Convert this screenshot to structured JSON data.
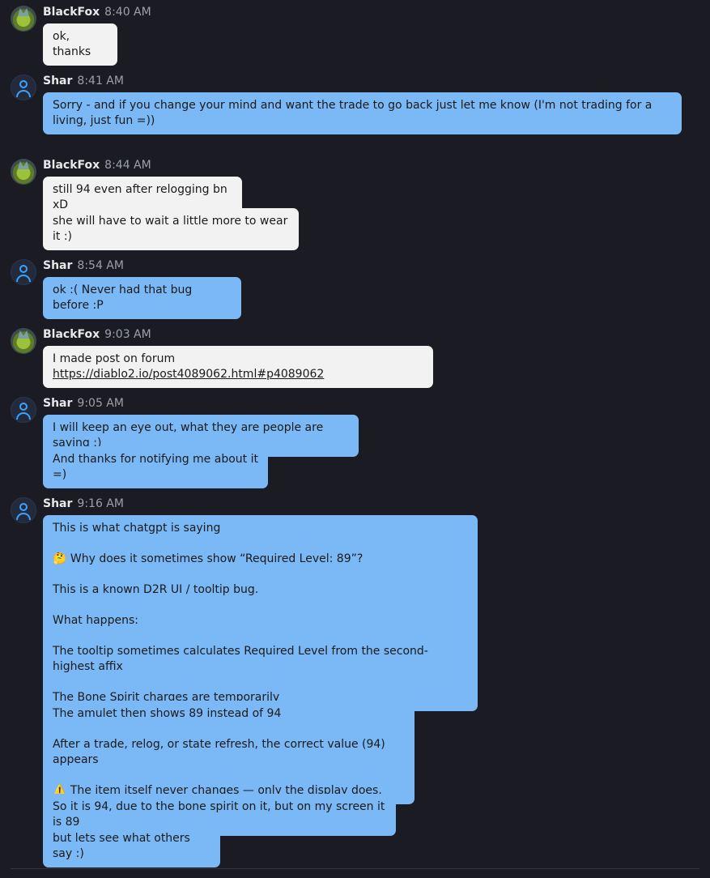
{
  "messages": [
    {
      "author": "BlackFox",
      "time": "8:40 AM",
      "bubbles": [
        "ok, thanks"
      ]
    },
    {
      "author": "Shar",
      "time": "8:41 AM",
      "bubbles": [
        "Sorry - and if you change your mind and want the trade to go back just let me know (I'm not trading for a living, just fun =))"
      ]
    },
    {
      "author": "BlackFox",
      "time": "8:44 AM",
      "bubbles": [
        "still 94 even after relogging bn xD",
        "she will have to wait a little more to wear it :)"
      ]
    },
    {
      "author": "Shar",
      "time": "8:54 AM",
      "bubbles": [
        "ok :( Never had that bug before :P"
      ]
    },
    {
      "author": "BlackFox",
      "time": "9:03 AM",
      "bubble_prefix": "I made post on forum ",
      "link": "https://diablo2.io/post4089062.html#p4089062"
    },
    {
      "author": "Shar",
      "time": "9:05 AM",
      "bubbles": [
        "I will keep an eye out, what they are people are saying :)",
        "And thanks for notifying me about it =)"
      ]
    },
    {
      "author": "Shar",
      "time": "9:16 AM",
      "bubble_a": [
        "This is what chatgpt is saying",
        "🤔 Why does it sometimes show “Required Level: 89”?",
        "This is a known D2R UI / tooltip bug.",
        "What happens:",
        "The tooltip sometimes calculates Required Level from the second-highest affix",
        "The Bone Spirit charges are temporarily"
      ],
      "bubble_b": [
        "The amulet then shows 89 instead of 94",
        "After a trade, relog, or state refresh, the correct value (94) appears",
        "⚠️ The item itself never changes — only the display does."
      ],
      "bubbles": [
        "So it is 94, due to the bone spirit on it, but on my screen it is 89",
        "but lets see what others say :)"
      ]
    }
  ],
  "colors": {
    "background": "#1b1c23",
    "their_bubble": "#f2f2f3",
    "my_bubble": "#7ab9f6",
    "avatar_accent": "#3ba3ff"
  }
}
